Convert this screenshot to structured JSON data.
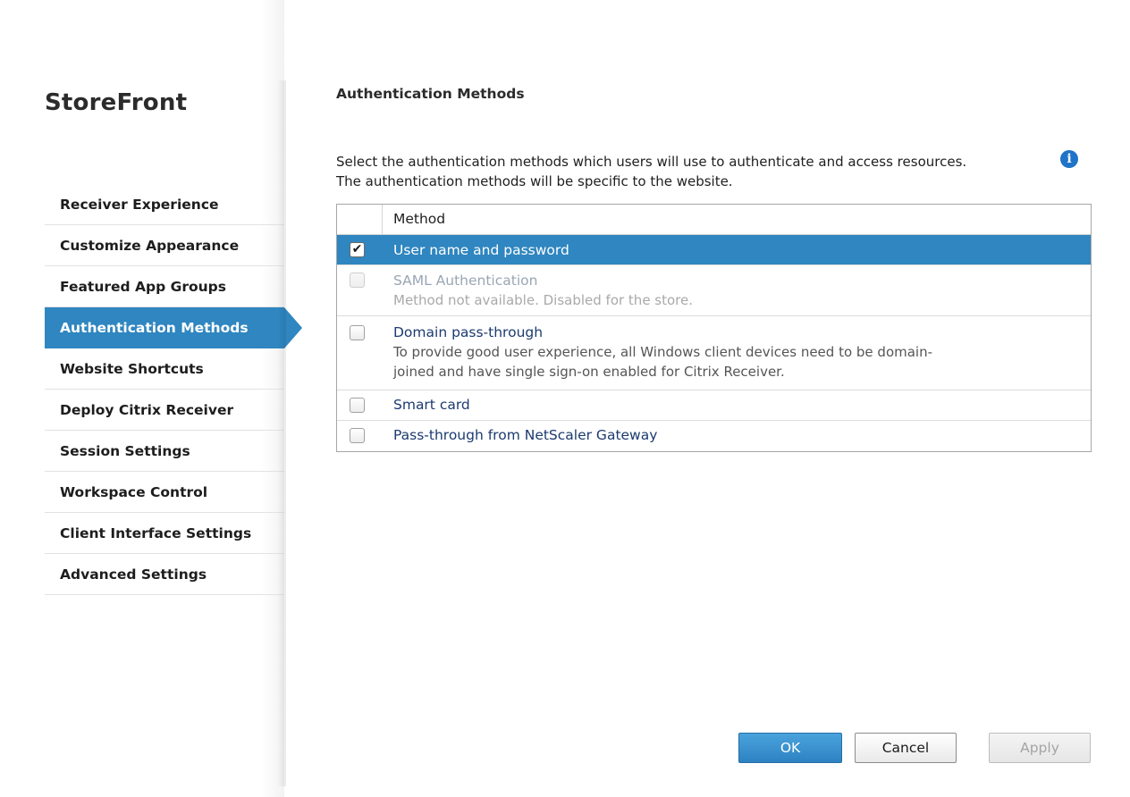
{
  "app": {
    "title": "StoreFront"
  },
  "sidebar": {
    "items": [
      {
        "label": "Receiver Experience",
        "active": false
      },
      {
        "label": "Customize Appearance",
        "active": false
      },
      {
        "label": "Featured App Groups",
        "active": false
      },
      {
        "label": "Authentication Methods",
        "active": true
      },
      {
        "label": "Website Shortcuts",
        "active": false
      },
      {
        "label": "Deploy Citrix Receiver",
        "active": false
      },
      {
        "label": "Session Settings",
        "active": false
      },
      {
        "label": "Workspace Control",
        "active": false
      },
      {
        "label": "Client Interface Settings",
        "active": false
      },
      {
        "label": "Advanced Settings",
        "active": false
      }
    ]
  },
  "main": {
    "title": "Authentication Methods",
    "description_line1": "Select the authentication methods which users will use to authenticate and access resources.",
    "description_line2": "The authentication methods will be specific to the website.",
    "info_icon": "info-icon",
    "table": {
      "column_header": "Method",
      "rows": [
        {
          "name": "User name and password",
          "checked": true,
          "selected": true,
          "disabled": false
        },
        {
          "name": "SAML Authentication",
          "sub": "Method not available. Disabled for the store.",
          "checked": false,
          "selected": false,
          "disabled": true
        },
        {
          "name": "Domain pass-through",
          "sub_line1": "To provide good user experience, all Windows client devices need to be domain-",
          "sub_line2": "joined and have single sign-on enabled for Citrix Receiver.",
          "checked": false,
          "selected": false,
          "disabled": false
        },
        {
          "name": "Smart card",
          "checked": false,
          "selected": false,
          "disabled": false
        },
        {
          "name": "Pass-through from NetScaler Gateway",
          "checked": false,
          "selected": false,
          "disabled": false
        }
      ]
    }
  },
  "footer": {
    "ok_label": "OK",
    "cancel_label": "Cancel",
    "apply_label": "Apply"
  },
  "colors": {
    "accent": "#2f86c0",
    "info": "#1f73c8"
  }
}
